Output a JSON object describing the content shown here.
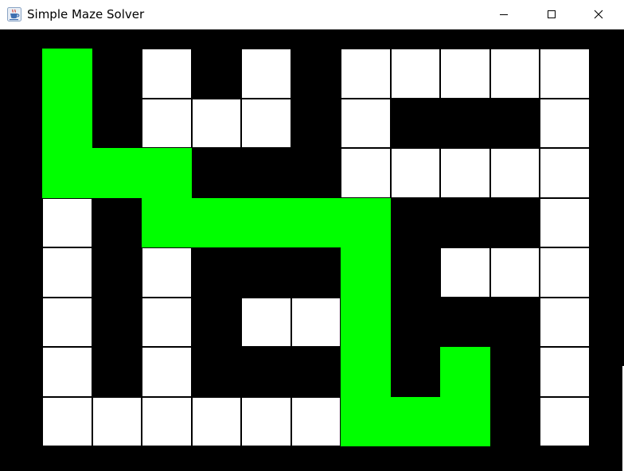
{
  "window": {
    "title": "Simple Maze Solver",
    "icon": "java-coffee-cup-icon",
    "controls": [
      "minimize-icon",
      "maximize-icon",
      "close-icon"
    ]
  },
  "maze": {
    "rows": 8,
    "cols": 11,
    "legend": {
      "0": "wall",
      "1": "open",
      "2": "solution path"
    },
    "colors": {
      "wall": "#000000",
      "open": "#ffffff",
      "path": "#00ff00"
    },
    "cells": [
      [
        2,
        0,
        1,
        0,
        1,
        0,
        1,
        1,
        1,
        1,
        1
      ],
      [
        2,
        0,
        1,
        1,
        1,
        0,
        1,
        0,
        0,
        0,
        1
      ],
      [
        2,
        2,
        2,
        0,
        0,
        0,
        1,
        1,
        1,
        1,
        1
      ],
      [
        1,
        0,
        2,
        2,
        2,
        2,
        2,
        0,
        0,
        0,
        1
      ],
      [
        1,
        0,
        1,
        0,
        0,
        0,
        2,
        0,
        1,
        1,
        1
      ],
      [
        1,
        0,
        1,
        0,
        1,
        1,
        2,
        0,
        0,
        0,
        1
      ],
      [
        1,
        0,
        1,
        0,
        0,
        0,
        2,
        0,
        2,
        0,
        1
      ],
      [
        1,
        1,
        1,
        1,
        1,
        1,
        2,
        2,
        2,
        0,
        1
      ]
    ]
  }
}
